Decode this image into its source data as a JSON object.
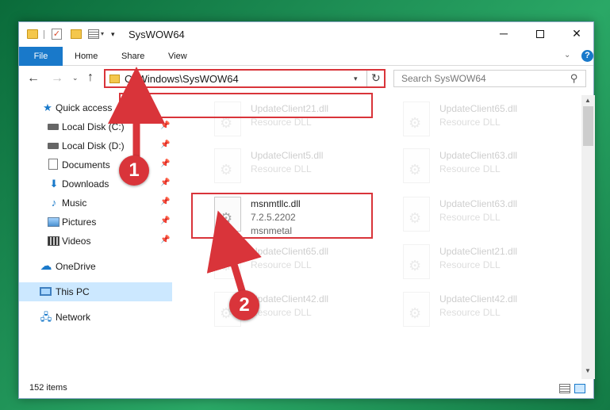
{
  "window": {
    "title": "SysWOW64",
    "controls": {
      "minimize": "─",
      "maximize": "",
      "close": "✕"
    }
  },
  "ribbon": {
    "tabs": [
      "File",
      "Home",
      "Share",
      "View"
    ],
    "collapse_glyph": "⌄",
    "help_glyph": "?"
  },
  "nav": {
    "back": "←",
    "forward": "→",
    "recent": "⌄",
    "up": "↑",
    "address": "C:\\Windows\\SysWOW64",
    "refresh": "↻",
    "search_placeholder": "Search SysWOW64"
  },
  "sidebar": {
    "items": [
      {
        "label": "Quick access",
        "icon": "star-icon"
      },
      {
        "label": "Local Disk (C:)",
        "icon": "disk-icon",
        "pinned": true
      },
      {
        "label": "Local Disk (D:)",
        "icon": "disk-icon",
        "pinned": true
      },
      {
        "label": "Documents",
        "icon": "documents-icon",
        "pinned": true
      },
      {
        "label": "Downloads",
        "icon": "downloads-icon",
        "pinned": true
      },
      {
        "label": "Music",
        "icon": "music-icon",
        "pinned": true
      },
      {
        "label": "Pictures",
        "icon": "pictures-icon",
        "pinned": true
      },
      {
        "label": "Videos",
        "icon": "videos-icon",
        "pinned": true
      },
      {
        "label": "OneDrive",
        "icon": "onedrive-icon"
      },
      {
        "label": "This PC",
        "icon": "computer-icon",
        "selected": true
      },
      {
        "label": "Network",
        "icon": "network-icon"
      }
    ]
  },
  "files": [
    {
      "name": "UpdateClient21.dll",
      "sub": "Resource DLL",
      "faded": true
    },
    {
      "name": "UpdateClient65.dll",
      "sub": "Resource DLL",
      "faded": true
    },
    {
      "name": "UpdateClient5.dll",
      "sub": "Resource DLL",
      "faded": true
    },
    {
      "name": "UpdateClient63.dll",
      "sub": "Resource DLL",
      "faded": true
    },
    {
      "name": "msnmtllc.dll",
      "sub": "7.2.5.2202",
      "sub2": "msnmetal",
      "faded": false,
      "highlighted": true
    },
    {
      "name": "UpdateClient63.dll",
      "sub": "Resource DLL",
      "faded": true
    },
    {
      "name": "UpdateClient65.dll",
      "sub": "Resource DLL",
      "faded": true
    },
    {
      "name": "UpdateClient21.dll",
      "sub": "Resource DLL",
      "faded": true
    },
    {
      "name": "UpdateClient42.dll",
      "sub": "Resource DLL",
      "faded": true
    },
    {
      "name": "UpdateClient42.dll",
      "sub": "Resource DLL",
      "faded": true
    }
  ],
  "status": {
    "item_count": "152 items"
  },
  "annotations": {
    "step1": "1",
    "step2": "2",
    "color": "#d9343a"
  }
}
